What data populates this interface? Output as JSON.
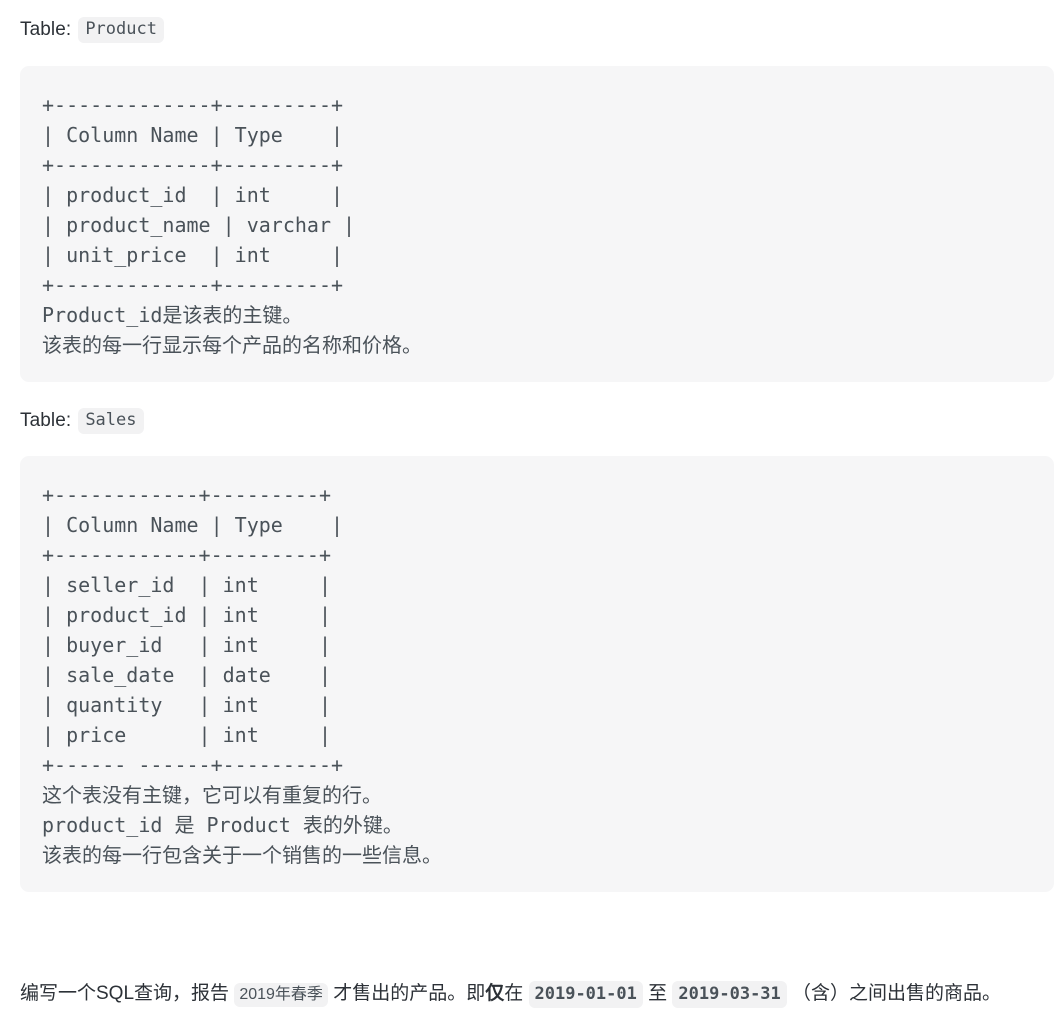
{
  "sections": [
    {
      "label_prefix": "Table:",
      "table_name": "Product",
      "code": "+-------------+---------+\n| Column Name | Type    |\n+-------------+---------+\n| product_id  | int     |\n| product_name | varchar |\n| unit_price  | int     |\n+-------------+---------+\nProduct_id是该表的主键。\n该表的每一行显示每个产品的名称和价格。"
    },
    {
      "label_prefix": "Table:",
      "table_name": "Sales",
      "code": "+------------+---------+\n| Column Name | Type    |\n+------------+---------+\n| seller_id  | int     |\n| product_id | int     |\n| buyer_id   | int     |\n| sale_date  | date    |\n| quantity   | int     |\n| price      | int     |\n+------ ------+---------+\n这个表没有主键，它可以有重复的行。\nproduct_id 是 Product 表的外键。\n该表的每一行包含关于一个销售的一些信息。"
    }
  ],
  "prompt": {
    "part1": "编写一个SQL查询，报告 ",
    "badge_season": "2019年春季",
    "part2": " 才售出的产品。即",
    "emphasis": "仅",
    "part3": "在 ",
    "badge_date_start": "2019-01-01",
    "part4": " 至 ",
    "badge_date_end": "2019-03-31",
    "part5": " （含）之间出售的商品。"
  },
  "colors": {
    "page_background": "#ffffff",
    "code_block_background": "#f6f6f7",
    "inline_code_background": "#f2f2f3",
    "code_text": "#4a5259",
    "body_text": "#2c3137"
  }
}
